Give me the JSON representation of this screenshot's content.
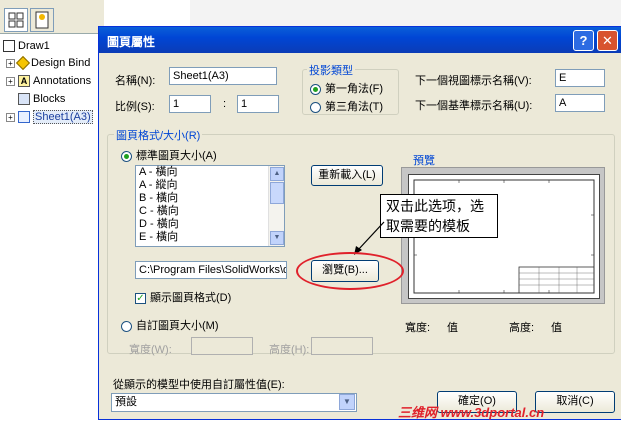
{
  "tree": {
    "items": [
      {
        "label": "Draw1",
        "icon": "drawing-icon"
      },
      {
        "label": "Design Bind",
        "icon": "design-binder-icon"
      },
      {
        "label": "Annotations",
        "icon": "annotations-icon"
      },
      {
        "label": "Blocks",
        "icon": "blocks-icon"
      },
      {
        "label": "Sheet1(A3)",
        "icon": "sheet-icon"
      }
    ]
  },
  "dialog": {
    "title": "圖頁屬性",
    "name_label": "名稱(N):",
    "name_value": "Sheet1(A3)",
    "scale_label": "比例(S):",
    "scale_value1": "1",
    "scale_colon": ":",
    "scale_value2": "1",
    "projection": {
      "title": "投影類型",
      "first": "第一角法(F)",
      "third": "第三角法(T)"
    },
    "next_view_label": "下一個視圖標示名稱(V):",
    "next_view_value": "E",
    "next_datum_label": "下一個基準標示名稱(U):",
    "next_datum_value": "A",
    "format": {
      "title": "圖頁格式/大小(R)",
      "standard": "標準圖頁大小(A)",
      "list": [
        "A - 橫向",
        "A - 縱向",
        "B - 橫向",
        "C - 橫向",
        "D - 橫向",
        "E - 橫向"
      ],
      "reload_label": "重新載入(L)",
      "path": "C:\\Program Files\\SolidWorks\\d",
      "browse_label": "瀏覽(B)...",
      "display_format": "顯示圖頁格式(D)",
      "custom": "自訂圖頁大小(M)",
      "width_label": "寬度(W):",
      "height_label": "高度(H):"
    },
    "preview": {
      "title": "預覽",
      "width_label": "寬度:",
      "width_value": "值",
      "height_label": "高度:",
      "height_value": "值"
    },
    "props_label": "從顯示的模型中使用自訂屬性值(E):",
    "props_value": "預設",
    "ok_label": "確定(O)",
    "cancel_label": "取消(C)"
  },
  "annotation": {
    "callout_line1": "双击此选项，选",
    "callout_line2": "取需要的模板"
  },
  "watermark": "三维网 www.3dportal.cn",
  "colors": {
    "titlebar": "#0046d5",
    "dialog_bg": "#ece9d8",
    "highlight_red": "#e0212b",
    "group_title": "#0046d5"
  }
}
